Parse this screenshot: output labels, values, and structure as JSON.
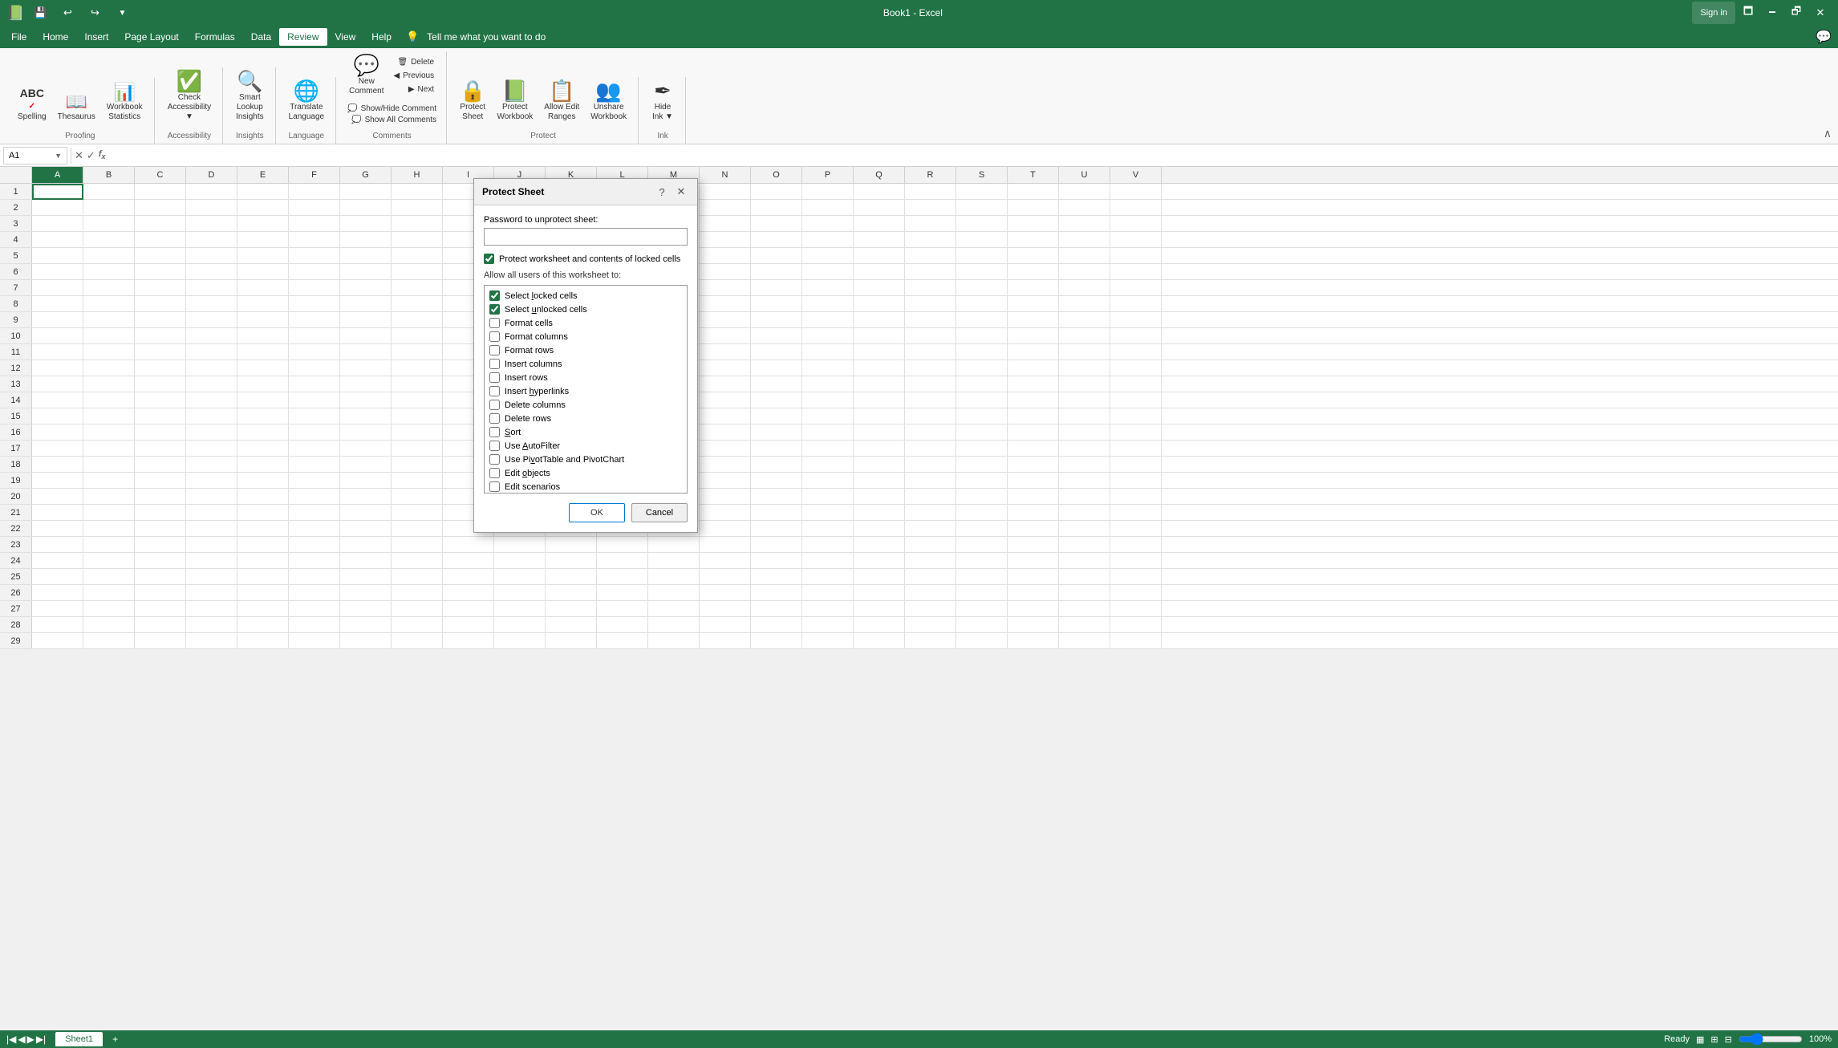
{
  "titleBar": {
    "quickSave": "💾",
    "undo": "↩",
    "redo": "↪",
    "title": "Book1 - Excel",
    "signIn": "Sign in",
    "minimize": "🗕",
    "maximize": "🗗",
    "close": "✕"
  },
  "menuBar": {
    "items": [
      "File",
      "Home",
      "Insert",
      "Page Layout",
      "Formulas",
      "Data",
      "Review",
      "View",
      "Help",
      "Tell me what you want to do"
    ],
    "activeItem": "Review",
    "helpIcon": "💡"
  },
  "ribbon": {
    "groups": [
      {
        "name": "Proofing",
        "items": [
          {
            "id": "spelling",
            "icon": "ABC\n✓",
            "label": "Spelling"
          },
          {
            "id": "thesaurus",
            "icon": "📖",
            "label": "Thesaurus"
          },
          {
            "id": "workbook-statistics",
            "icon": "📊",
            "label": "Workbook\nStatistics"
          }
        ]
      },
      {
        "name": "Accessibility",
        "items": [
          {
            "id": "check-accessibility",
            "icon": "✓",
            "label": "Check\nAccessibility\nAccessibility"
          }
        ]
      },
      {
        "name": "Insights",
        "items": [
          {
            "id": "smart-lookup",
            "icon": "🔍",
            "label": "Smart\nLookup\nInsights"
          }
        ]
      },
      {
        "name": "Language",
        "items": [
          {
            "id": "translate",
            "icon": "🌐",
            "label": "Translate\nLanguage"
          }
        ]
      },
      {
        "name": "Comments",
        "items": [
          {
            "id": "new-comment",
            "icon": "💬",
            "label": "New\nComment"
          },
          {
            "id": "delete",
            "icon": "🗑",
            "label": "Delete"
          },
          {
            "id": "previous",
            "icon": "◀",
            "label": "Previous"
          },
          {
            "id": "next",
            "icon": "▶",
            "label": "Next"
          }
        ],
        "extras": [
          "Show/Hide Comment",
          "Show All Comments"
        ]
      },
      {
        "name": "Protect",
        "items": [
          {
            "id": "protect-sheet",
            "icon": "🔒",
            "label": "Protect\nSheet"
          },
          {
            "id": "protect-workbook",
            "icon": "📒🔒",
            "label": "Protect\nWorkbook"
          },
          {
            "id": "allow-edit-ranges",
            "icon": "📋",
            "label": "Allow Edit\nRanges"
          },
          {
            "id": "unshare-workbook",
            "icon": "👥",
            "label": "Unshare\nWorkbook"
          }
        ]
      },
      {
        "name": "Ink",
        "items": [
          {
            "id": "hide-ink",
            "icon": "✒",
            "label": "Hide\nInk"
          }
        ]
      }
    ]
  },
  "formulaBar": {
    "nameBox": "A1",
    "formula": ""
  },
  "columns": [
    "A",
    "B",
    "C",
    "D",
    "E",
    "F",
    "G",
    "H",
    "I",
    "J",
    "K",
    "L",
    "M",
    "N",
    "O",
    "P",
    "Q",
    "R",
    "S",
    "T",
    "U",
    "V"
  ],
  "rows": [
    1,
    2,
    3,
    4,
    5,
    6,
    7,
    8,
    9,
    10,
    11,
    12,
    13,
    14,
    15,
    16,
    17,
    18,
    19,
    20,
    21,
    22,
    23,
    24,
    25,
    26,
    27,
    28,
    29
  ],
  "dialog": {
    "title": "Protect Sheet",
    "helpIcon": "?",
    "closeIcon": "✕",
    "passwordLabel": "Password to unprotect sheet:",
    "passwordValue": "",
    "passwordPlaceholder": "",
    "protectCheckboxLabel": "Protect worksheet and contents of locked cells",
    "protectChecked": true,
    "allowLabel": "Allow all users of this worksheet to:",
    "permissions": [
      {
        "id": "select-locked",
        "label": "Select locked cells",
        "checked": true
      },
      {
        "id": "select-unlocked",
        "label": "Select unlocked cells",
        "checked": true
      },
      {
        "id": "format-cells",
        "label": "Format cells",
        "checked": false
      },
      {
        "id": "format-columns",
        "label": "Format columns",
        "checked": false
      },
      {
        "id": "format-rows",
        "label": "Format rows",
        "checked": false
      },
      {
        "id": "insert-columns",
        "label": "Insert columns",
        "checked": false
      },
      {
        "id": "insert-rows",
        "label": "Insert rows",
        "checked": false
      },
      {
        "id": "insert-hyperlinks",
        "label": "Insert hyperlinks",
        "checked": false
      },
      {
        "id": "delete-columns",
        "label": "Delete columns",
        "checked": false
      },
      {
        "id": "delete-rows",
        "label": "Delete rows",
        "checked": false
      },
      {
        "id": "sort",
        "label": "Sort",
        "checked": false
      },
      {
        "id": "use-autofilter",
        "label": "Use AutoFilter",
        "checked": false
      },
      {
        "id": "use-pivottable",
        "label": "Use PivotTable and PivotChart",
        "checked": false
      },
      {
        "id": "edit-objects",
        "label": "Edit objects",
        "checked": false
      },
      {
        "id": "edit-scenarios",
        "label": "Edit scenarios",
        "checked": false
      }
    ],
    "okLabel": "OK",
    "cancelLabel": "Cancel"
  },
  "statusBar": {
    "sheetName": "Sheet1",
    "addSheet": "+",
    "ready": "Ready",
    "zoom": "100%"
  }
}
